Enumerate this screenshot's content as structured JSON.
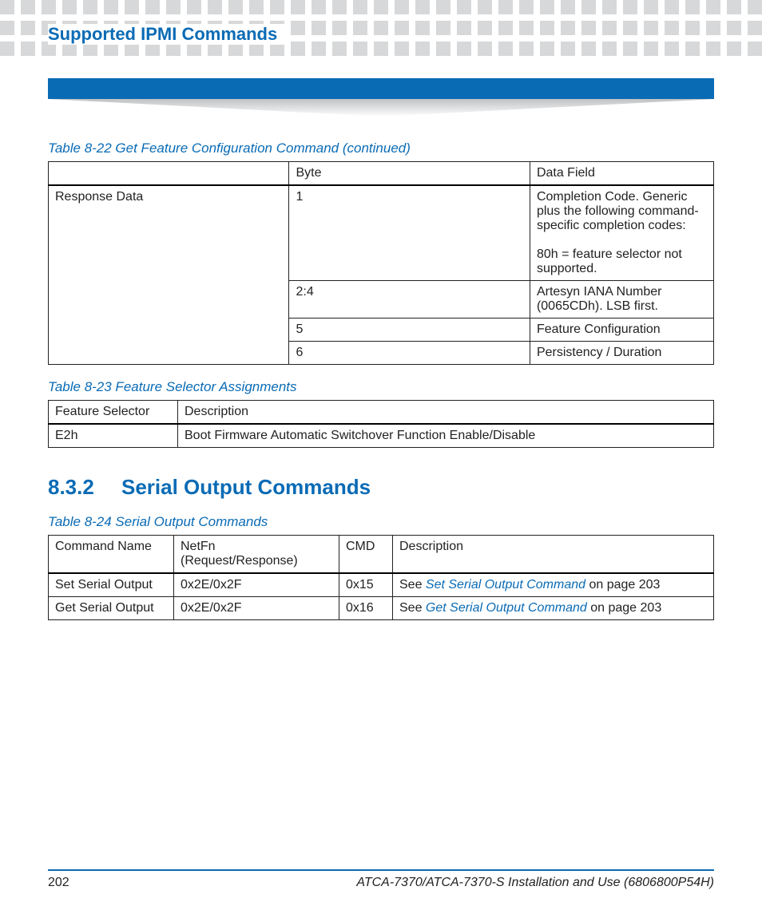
{
  "chapter_title": "Supported IPMI Commands",
  "table822": {
    "caption": "Table 8-22 Get Feature Configuration Command (continued)",
    "headers": {
      "c1": "",
      "c2": "Byte",
      "c3": "Data Field"
    },
    "rowgroup_label": "Response Data",
    "rows": [
      {
        "byte": "1",
        "field": "Completion Code. Generic plus the following command-specific completion codes:\n\n80h = feature selector not supported."
      },
      {
        "byte": "2:4",
        "field": "Artesyn IANA Number (0065CDh). LSB first."
      },
      {
        "byte": "5",
        "field": "Feature Configuration"
      },
      {
        "byte": "6",
        "field": "Persistency / Duration"
      }
    ]
  },
  "table823": {
    "caption": "Table 8-23 Feature Selector Assignments",
    "headers": {
      "c1": "Feature Selector",
      "c2": "Description"
    },
    "rows": [
      {
        "sel": "E2h",
        "desc": "Boot Firmware Automatic Switchover Function Enable/Disable"
      }
    ]
  },
  "section": {
    "num": "8.3.2",
    "title": "Serial Output Commands"
  },
  "table824": {
    "caption": "Table 8-24 Serial Output Commands",
    "headers": {
      "c1": "Command Name",
      "c2": "NetFn (Request/Response)",
      "c3": "CMD",
      "c4": "Description"
    },
    "rows": [
      {
        "name": "Set Serial Output",
        "netfn": "0x2E/0x2F",
        "cmd": "0x15",
        "desc_pre": "See ",
        "link": "Set Serial Output Command",
        "desc_post": " on page 203"
      },
      {
        "name": "Get Serial Output",
        "netfn": "0x2E/0x2F",
        "cmd": "0x16",
        "desc_pre": "See ",
        "link": "Get Serial Output Command",
        "desc_post": " on page 203"
      }
    ]
  },
  "footer": {
    "page": "202",
    "doc": "ATCA-7370/ATCA-7370-S Installation and Use (6806800P54H)"
  }
}
